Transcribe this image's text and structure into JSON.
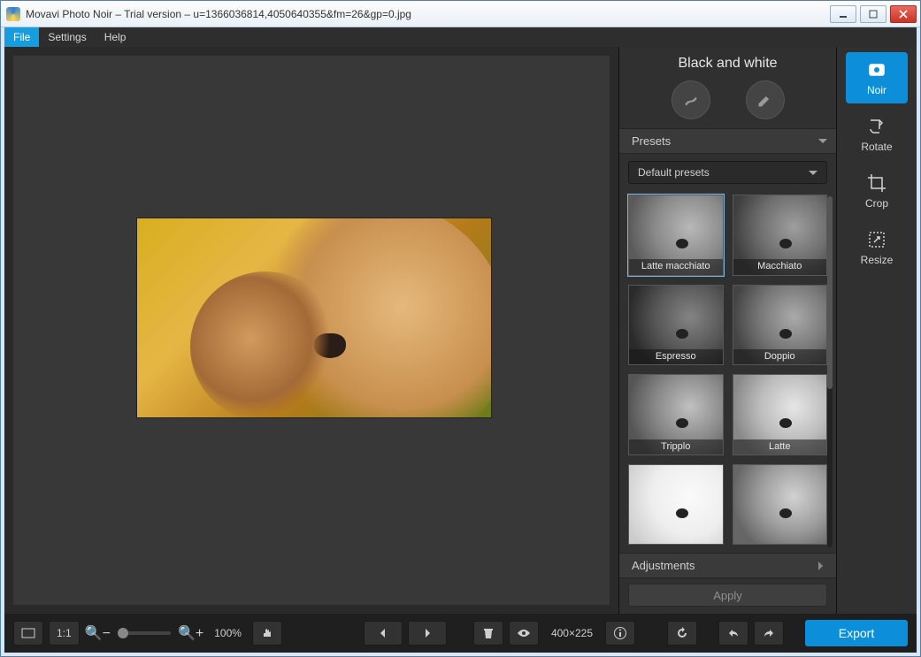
{
  "window": {
    "title": "Movavi Photo Noir – Trial version – u=1366036814,4050640355&fm=26&gp=0.jpg"
  },
  "menu": {
    "items": [
      "File",
      "Settings",
      "Help"
    ],
    "selected_index": 0
  },
  "panel": {
    "title": "Black and white",
    "presets_label": "Presets",
    "adjustments_label": "Adjustments",
    "dropdown": "Default presets",
    "apply_label": "Apply",
    "presets": [
      {
        "name": "Latte macchiato",
        "variant": "v0",
        "selected": true
      },
      {
        "name": "Macchiato",
        "variant": "v1",
        "selected": false
      },
      {
        "name": "Espresso",
        "variant": "v2",
        "selected": false
      },
      {
        "name": "Doppio",
        "variant": "v3",
        "selected": false
      },
      {
        "name": "Tripplo",
        "variant": "v4",
        "selected": false
      },
      {
        "name": "Latte",
        "variant": "v5",
        "selected": false
      },
      {
        "name": "",
        "variant": "v6",
        "selected": false
      },
      {
        "name": "",
        "variant": "v7",
        "selected": false
      }
    ]
  },
  "tools": {
    "items": [
      {
        "name": "Noir",
        "active": true
      },
      {
        "name": "Rotate",
        "active": false
      },
      {
        "name": "Crop",
        "active": false
      },
      {
        "name": "Resize",
        "active": false
      }
    ]
  },
  "bottom": {
    "ratio_label": "1:1",
    "zoom_percent": "100%",
    "dimensions": "400×225",
    "export_label": "Export"
  }
}
